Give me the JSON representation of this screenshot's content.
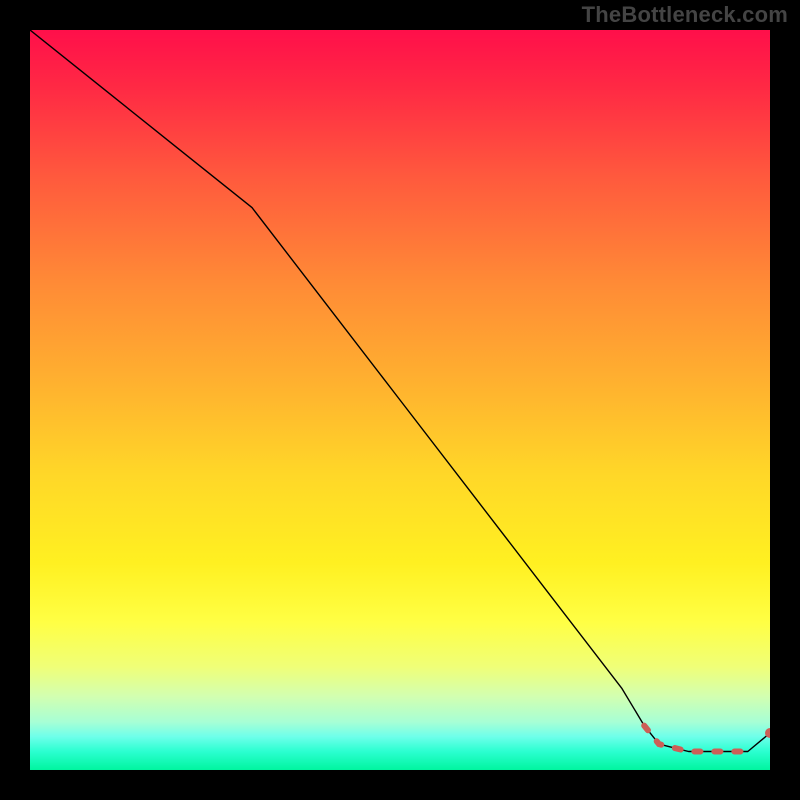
{
  "watermark": "TheBottleneck.com",
  "colors": {
    "background": "#000000",
    "line": "#000000",
    "marker": "#cc5f57"
  },
  "chart_data": {
    "type": "line",
    "title": "",
    "xlabel": "",
    "ylabel": "",
    "xlim": [
      0,
      100
    ],
    "ylim": [
      0,
      100
    ],
    "grid": false,
    "legend": false,
    "series": [
      {
        "name": "curve",
        "x": [
          0,
          10,
          20,
          30,
          40,
          50,
          60,
          70,
          80,
          83,
          85,
          87,
          89,
          91,
          93,
          95,
          97,
          100
        ],
        "y": [
          100,
          92,
          84,
          76,
          63,
          50,
          37,
          24,
          11,
          6,
          3.5,
          3,
          2.5,
          2.5,
          2.5,
          2.5,
          2.5,
          5
        ]
      }
    ],
    "highlight": {
      "name": "dashed-segment",
      "x": [
        83,
        85,
        87,
        89,
        91,
        93,
        95,
        97
      ],
      "y": [
        6,
        3.5,
        3,
        2.5,
        2.5,
        2.5,
        2.5,
        2.5
      ]
    },
    "end_point": {
      "x": 100,
      "y": 5
    }
  }
}
